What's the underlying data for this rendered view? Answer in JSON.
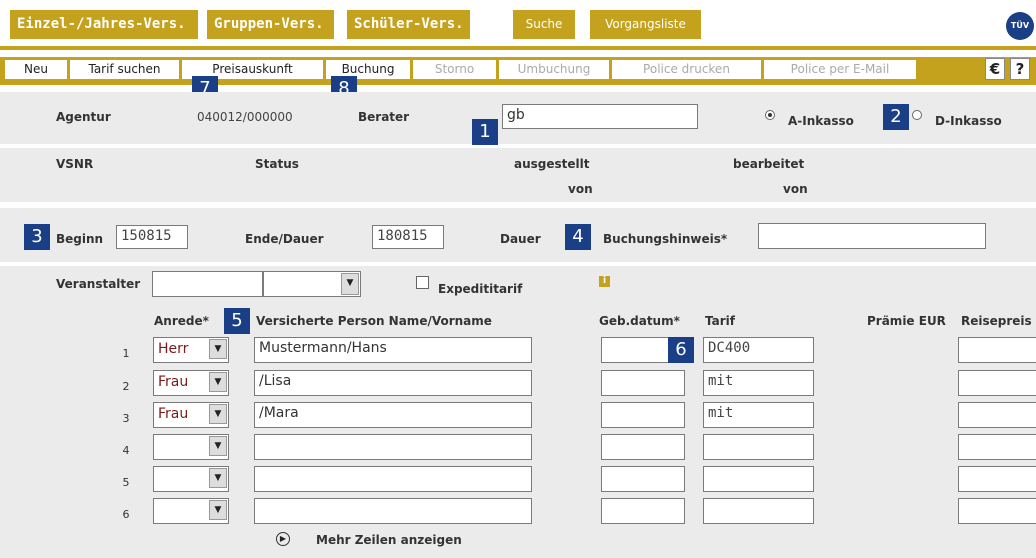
{
  "tabs": [
    "Einzel-/Jahres-Vers.",
    "Gruppen-Vers.",
    "Schüler-Vers.",
    "Suche",
    "Vorgangsliste"
  ],
  "logo": "TÜV",
  "subnav": [
    "Neu",
    "Tarif suchen",
    "Preisauskunft",
    "Buchung",
    "Storno",
    "Umbuchung",
    "Police drucken",
    "Police per E-Mail"
  ],
  "utility": [
    "€",
    "?"
  ],
  "badges": [
    "1",
    "2",
    "3",
    "4",
    "5",
    "6",
    "7",
    "8"
  ],
  "agentur_label": "Agentur",
  "agentur_value": "040012/000000",
  "berater_label": "Berater",
  "berater_value": "gb",
  "inkasso_a": "A-Inkasso",
  "inkasso_d": "D-Inkasso",
  "vsnr_label": "VSNR",
  "status_label": "Status",
  "ausgestellt_label": "ausgestellt",
  "bearbeitet_label": "bearbeitet",
  "von1": "von",
  "von2": "von",
  "beginn_label": "Beginn",
  "beginn_value": "150815",
  "ende_label": "Ende/Dauer",
  "ende_value": "180815",
  "dauer_label": "Dauer",
  "buchungshinweis_label": "Buchungshinweis*",
  "buchungshinweis_value": "",
  "veranstalter_label": "Veranstalter",
  "veranstalter_value": "",
  "expedient_label": "Expedititarif",
  "info_icon": "i",
  "headers": {
    "anrede": "Anrede*",
    "name": "Versicherte Person Name/Vorname",
    "gebdatum": "Geb.datum*",
    "tarif": "Tarif",
    "praemie": "Prämie EUR",
    "reisepreis": "Reisepreis"
  },
  "rows": [
    {
      "num": "1",
      "anrede": "Herr",
      "name": "Mustermann/Hans",
      "geb": "",
      "tarif": "DC400"
    },
    {
      "num": "2",
      "anrede": "Frau",
      "name": "/Lisa",
      "geb": "",
      "tarif": "mit"
    },
    {
      "num": "3",
      "anrede": "Frau",
      "name": "/Mara",
      "geb": "",
      "tarif": "mit"
    },
    {
      "num": "4",
      "anrede": "",
      "name": "",
      "geb": "",
      "tarif": ""
    },
    {
      "num": "5",
      "anrede": "",
      "name": "",
      "geb": "",
      "tarif": ""
    },
    {
      "num": "6",
      "anrede": "",
      "name": "",
      "geb": "",
      "tarif": ""
    }
  ],
  "more_rows": "Mehr Zeilen anzeigen",
  "colors": {
    "gold": "#c5a21d",
    "badge": "#1b3f86",
    "band": "#ebebeb"
  }
}
